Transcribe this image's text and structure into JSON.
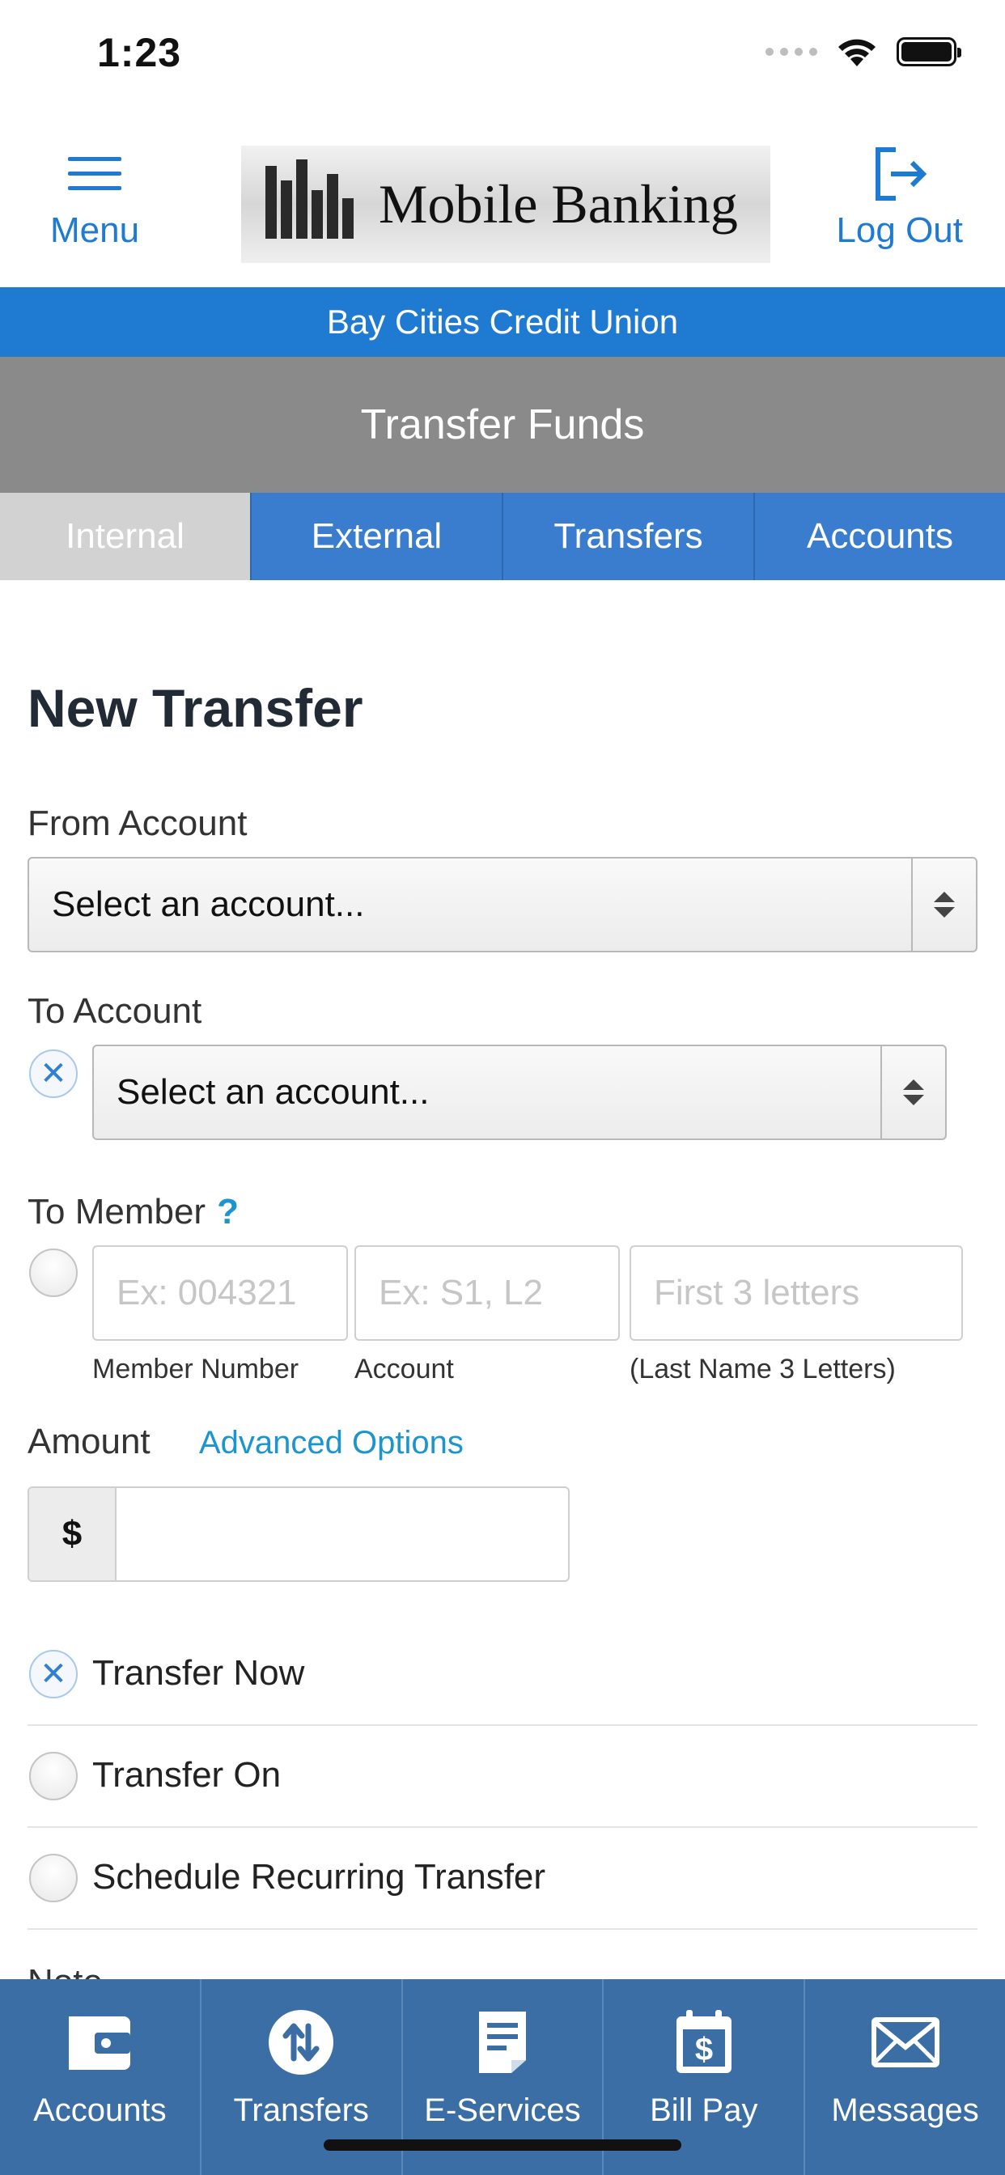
{
  "status_bar": {
    "time": "1:23"
  },
  "header": {
    "menu_label": "Menu",
    "logout_label": "Log Out",
    "logo_text": "Mobile Banking",
    "logo_small_text": "BAY CITIES CREDIT UNION"
  },
  "banner": {
    "text": "Bay Cities Credit Union"
  },
  "page": {
    "title": "Transfer Funds"
  },
  "tabs": [
    {
      "label": "Internal",
      "active": true
    },
    {
      "label": "External",
      "active": false
    },
    {
      "label": "Transfers",
      "active": false
    },
    {
      "label": "Accounts",
      "active": false
    }
  ],
  "form": {
    "title": "New Transfer",
    "from_account": {
      "label": "From Account",
      "value": "Select an account..."
    },
    "to_account": {
      "label": "To Account",
      "value": "Select an account..."
    },
    "to_member": {
      "label": "To Member",
      "help": "?",
      "member_number": {
        "placeholder": "Ex: 004321",
        "sub_label": "Member Number"
      },
      "account": {
        "placeholder": "Ex: S1, L2",
        "sub_label": "Account"
      },
      "last_name": {
        "placeholder": "First  3  letters",
        "sub_label": "(Last Name  3  Letters)"
      }
    },
    "amount": {
      "label": "Amount",
      "advanced_link": "Advanced Options",
      "currency": "$",
      "value": ""
    },
    "schedule_options": [
      {
        "label": "Transfer Now",
        "checked": true
      },
      {
        "label": "Transfer On",
        "checked": false
      },
      {
        "label": "Schedule Recurring Transfer",
        "checked": false
      }
    ],
    "note_label": "Note"
  },
  "bottom_nav": [
    {
      "label": "Accounts",
      "icon": "wallet-icon"
    },
    {
      "label": "Transfers",
      "icon": "transfer-arrows-icon"
    },
    {
      "label": "E-Services",
      "icon": "document-icon"
    },
    {
      "label": "Bill Pay",
      "icon": "calendar-dollar-icon"
    },
    {
      "label": "Messages",
      "icon": "envelope-icon"
    }
  ],
  "colors": {
    "primary_blue": "#1f7ad1",
    "tab_blue": "#3a7dcf",
    "nav_blue": "#3a6ea5",
    "header_gray": "#8a8a8a",
    "link_cyan": "#1c95cf"
  }
}
